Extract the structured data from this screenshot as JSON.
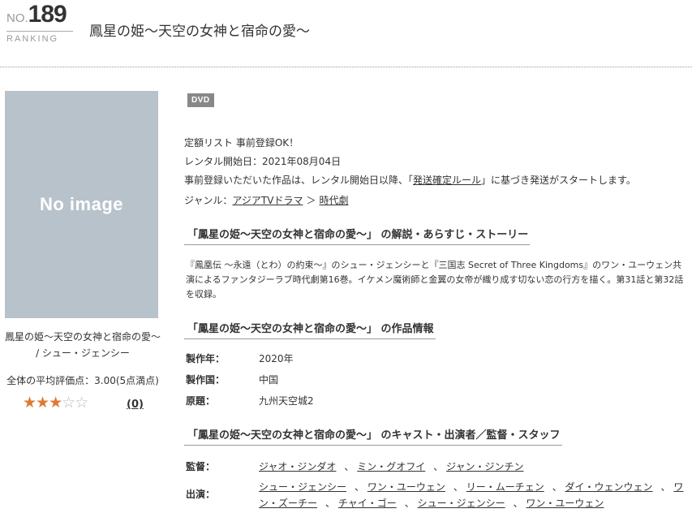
{
  "ranking": {
    "no": "NO.",
    "number": "189",
    "label": "RANKING"
  },
  "title": "鳳星の姫～天空の女神と宿命の愛～",
  "cover": {
    "placeholder": "No image"
  },
  "caption": "鳳星の姫～天空の女神と宿命の愛～ / シュー・ジェンシー",
  "rating": {
    "label": "全体の平均評価点：3.00(5点満点)",
    "stars": 3,
    "max": 5,
    "star_on_glyph": "★",
    "star_off_glyph": "☆",
    "review_count": "(0)"
  },
  "badge": "DVD",
  "info": {
    "line1": "定額リスト 事前登録OK！",
    "line2": "レンタル開始日：2021年08月04日",
    "line3_prefix": "事前登録いただいた作品は、レンタル開始日以降、「",
    "line3_link": "発送確定ルール",
    "line3_suffix": "」に基づき発送がスタートします。",
    "genre_label": "ジャンル：",
    "genre_1": "アジアTVドラマ",
    "genre_sep": "＞",
    "genre_2": "時代劇"
  },
  "sections": {
    "story_heading": "「鳳星の姫～天空の女神と宿命の愛～」 の解説・あらすじ・ストーリー",
    "story_text": "『鳳凰伝 ～永遠（とわ）の約束～』のシュー・ジェンシーと『三国志 Secret of Three Kingdoms』のワン・ユーウェン共演によるファンタジーラブ時代劇第16巻。イケメン魔術師と金翼の女帝が織り成す切ない恋の行方を描く。第31話と第32話を収録。",
    "info_heading": "「鳳星の姫～天空の女神と宿命の愛～」 の作品情報",
    "cast_heading": "「鳳星の姫～天空の女神と宿命の愛～」 のキャスト・出演者／監督・スタッフ"
  },
  "details": {
    "year_label": "製作年：",
    "year_value": "2020年",
    "country_label": "製作国：",
    "country_value": "中国",
    "original_label": "原題：",
    "original_value": "九州天空城2"
  },
  "staff": {
    "director_label": "監督：",
    "directors": [
      "ジャオ・ジンダオ",
      "ミン・グオフイ",
      "ジャン・ジンチン"
    ],
    "cast_label": "出演：",
    "cast": [
      "シュー・ジェンシー",
      "ワン・ユーウェン",
      "リー・ムーチェン",
      "ダイ・ウェンウェン",
      "ワン・ズーチー",
      "チャイ・ゴー",
      "シュー・ジェンシー",
      "ワン・ユーウェン"
    ]
  },
  "colors": {
    "star_on": "#e07a33",
    "star_off": "#bbbbbb",
    "cover_bg": "#b8c2cb",
    "badge_bg": "#888888"
  }
}
